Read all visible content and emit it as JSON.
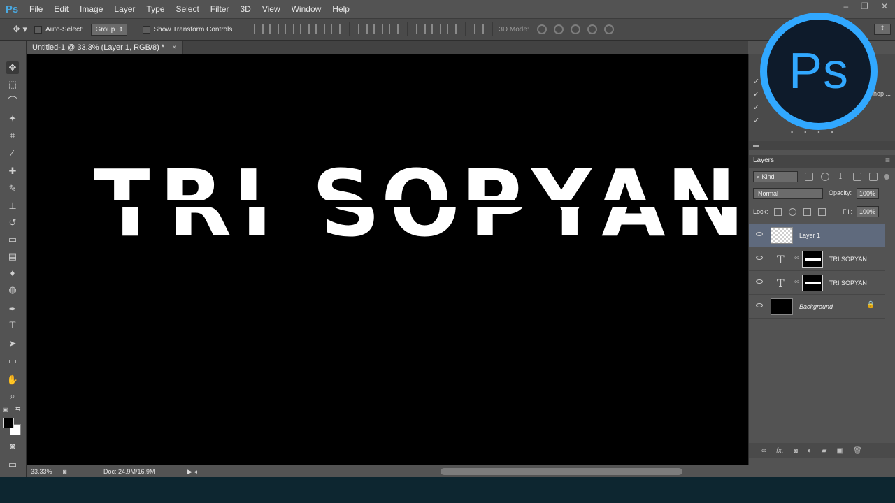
{
  "app": {
    "logo": "Ps",
    "menu": [
      "File",
      "Edit",
      "Image",
      "Layer",
      "Type",
      "Select",
      "Filter",
      "3D",
      "View",
      "Window",
      "Help"
    ]
  },
  "options_bar": {
    "auto_select_label": "Auto-Select:",
    "auto_select_value": "Group",
    "transform_controls_label": "Show Transform Controls",
    "mode_3d_label": "3D Mode:"
  },
  "document": {
    "tab_title": "Untitled-1 @ 33.3% (Layer 1, RGB/8) *",
    "canvas_text": "TRI SOPYAN"
  },
  "status_bar": {
    "zoom": "33.33%",
    "doc_size": "Doc: 24.9M/16.9M"
  },
  "history_panel": {
    "partial_text": "hop ..."
  },
  "layers_panel": {
    "title": "Layers",
    "kind_filter": "Kind",
    "blend_mode": "Normal",
    "opacity_label": "Opacity:",
    "opacity_value": "100%",
    "lock_label": "Lock:",
    "fill_label": "Fill:",
    "fill_value": "100%",
    "layers": [
      {
        "name": "Layer 1",
        "selected": true
      },
      {
        "name": "TRI SOPYAN ...",
        "type": "text"
      },
      {
        "name": "TRI SOPYAN",
        "type": "text"
      },
      {
        "name": "Background",
        "locked": true
      }
    ]
  },
  "watermark": {
    "text": "Ps"
  },
  "colors": {
    "ui_bg": "#535353",
    "canvas": "#000000",
    "accent": "#31a8ff",
    "selection": "#5f6a7d"
  }
}
